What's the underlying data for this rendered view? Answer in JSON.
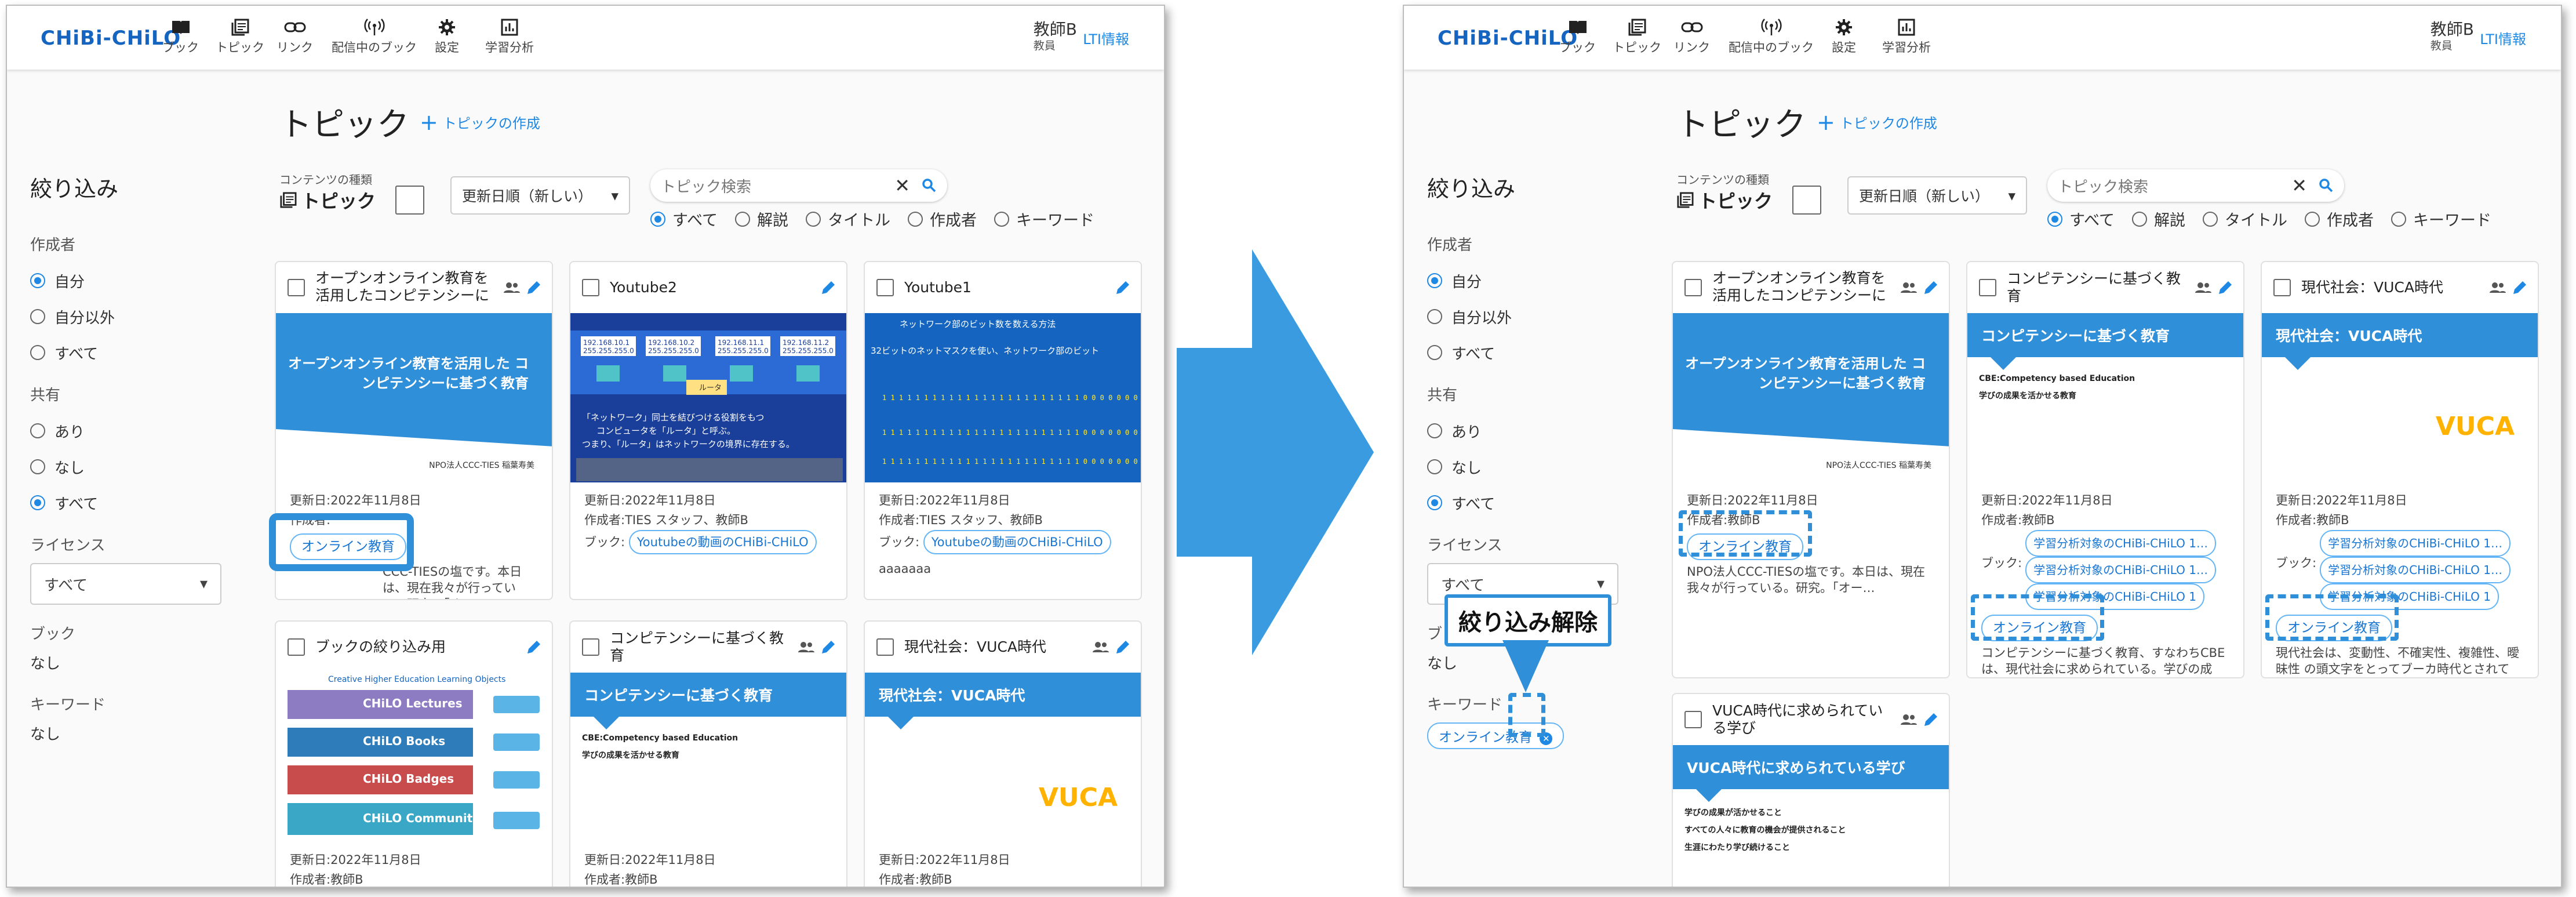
{
  "app": {
    "logo": "CHiBi-CHiLO",
    "nav": [
      "ブック",
      "トピック",
      "リンク",
      "配信中のブック",
      "設定",
      "学習分析"
    ],
    "user_name": "教師B",
    "user_role": "教員",
    "lti": "LTI情報"
  },
  "sidebar": {
    "title": "絞り込み",
    "author_label": "作成者",
    "author_options": [
      "自分",
      "自分以外",
      "すべて"
    ],
    "share_label": "共有",
    "share_options": [
      "あり",
      "なし",
      "すべて"
    ],
    "license_label": "ライセンス",
    "license_value": "すべて",
    "book_label": "ブック",
    "book_value": "なし",
    "keyword_label": "キーワード",
    "keyword_value": "なし",
    "keyword_chip": "オンライン教育"
  },
  "main": {
    "title": "トピック",
    "create": "トピックの作成",
    "content_type_label": "コンテンツの種類",
    "content_type": "トピック",
    "sort": "更新日順（新しい）",
    "search_placeholder": "トピック検索",
    "search_scope": [
      "すべて",
      "解説",
      "タイトル",
      "作成者",
      "キーワード"
    ]
  },
  "labels": {
    "updated_prefix": "更新日:",
    "author_prefix": "作成者:",
    "book_prefix": "ブック:"
  },
  "cards_before": [
    {
      "title": "オープンオンライン教育を活用したコンピテンシーに基…",
      "thumb_text": "オープンオンライン教育を活用した コンピテンシーに基づく教育",
      "thumb_org": "NPO法人CCC-TIES 稲葉寿美",
      "updated": "2022年11月8日",
      "author": "",
      "chip": "オンライン教育",
      "desc": "CCC-TIESの塩です。本日は、現在我々が行っている。研究。「オー…"
    },
    {
      "title": "Youtube2",
      "updated": "2022年11月8日",
      "author": "TIES スタッフ、教師B",
      "book": "Youtubeの動画のCHiBi-CHiLO"
    },
    {
      "title": "Youtube1",
      "updated": "2022年11月8日",
      "author": "TIES スタッフ、教師B",
      "book": "Youtubeの動画のCHiBi-CHiLO",
      "desc": "aaaaaaa"
    },
    {
      "title": "ブックの絞り込み用",
      "updated": "2022年11月8日",
      "author": "教師B"
    },
    {
      "title": "コンピテンシーに基づく教育",
      "updated": "2022年11月8日",
      "author": "教師B"
    },
    {
      "title": "現代社会：VUCA時代",
      "updated": "2022年11月8日",
      "author": "教師B"
    }
  ],
  "cards_after": [
    {
      "title": "オープンオンライン教育を活用したコンピテンシーに基…",
      "updated": "2022年11月8日",
      "author": "教師B",
      "chip": "オンライン教育",
      "desc": "NPO法人CCC-TIESの塩です。本日は、現在我々が行っている。研究。「オー…"
    },
    {
      "title": "コンピテンシーに基づく教育",
      "updated": "2022年11月8日",
      "author": "教師B",
      "books": [
        "学習分析対象のCHiBi-CHiLO 1…",
        "学習分析対象のCHiBi-CHiLO 1…",
        "学習分析対象のCHiBi-CHiLO 1"
      ],
      "chip": "オンライン教育",
      "desc": "コンピテンシーに基づく教育、すなわちCBEは、現代社会に求められている。学びの成果…"
    },
    {
      "title": "現代社会：VUCA時代",
      "updated": "2022年11月8日",
      "author": "教師B",
      "books": [
        "学習分析対象のCHiBi-CHiLO 1…",
        "学習分析対象のCHiBi-CHiLO 1…",
        "学習分析対象のCHiBi-CHiLO 1"
      ],
      "chip": "オンライン教育",
      "desc": "現代社会は、変動性、不確実性、複雑性、曖昧性 の頭文字をとってブーカ時代とされてい…"
    },
    {
      "title": "VUCA時代に求められている学び"
    }
  ],
  "thumbs": {
    "cbe_banner": "コンピテンシーに基づく教育",
    "cbe_bullets": [
      "CBE:Competency based Education",
      "学びの成果を活かせる教育"
    ],
    "vuca_banner": "現代社会：VUCA時代",
    "vuca_word": "VUCA",
    "learn_banner": "VUCA時代に求められている学び",
    "learn_bullets": [
      "学びの成果が活かせること",
      "すべての人々に教育の機会が提供されること",
      "生涯にわたり学び続けること"
    ],
    "net_ips": [
      "192.168.10.1",
      "192.168.10.2",
      "192.168.11.1",
      "192.168.11.2"
    ],
    "net_mask": "255.255.255.0",
    "net_router": "ルータ",
    "net_lines": [
      "「ネットワーク」同士を結びつける役割をもつ",
      "コンピュータを「ルータ」と呼ぶ。",
      "つまり、「ルータ」はネットワークの境界に存在する。"
    ],
    "mask_lines": [
      "ネットワーク部のビット数を数える方法",
      "32ビットのネットマスクを使い、ネットワーク部のビット",
      "1 1 1 1 1 1 1 1 1 1 1 1 1 1 1 1 1 1 1 1 1 1 1 1 0 0 0 0 0 0 0 0"
    ],
    "chilo_title": "Creative Higher Education Learning Objects",
    "chilo_items": [
      "CHiLO Lectures",
      "CHiLO Books",
      "CHiLO Badges",
      "CHiLO Communities"
    ]
  },
  "callout": "絞り込み解除"
}
